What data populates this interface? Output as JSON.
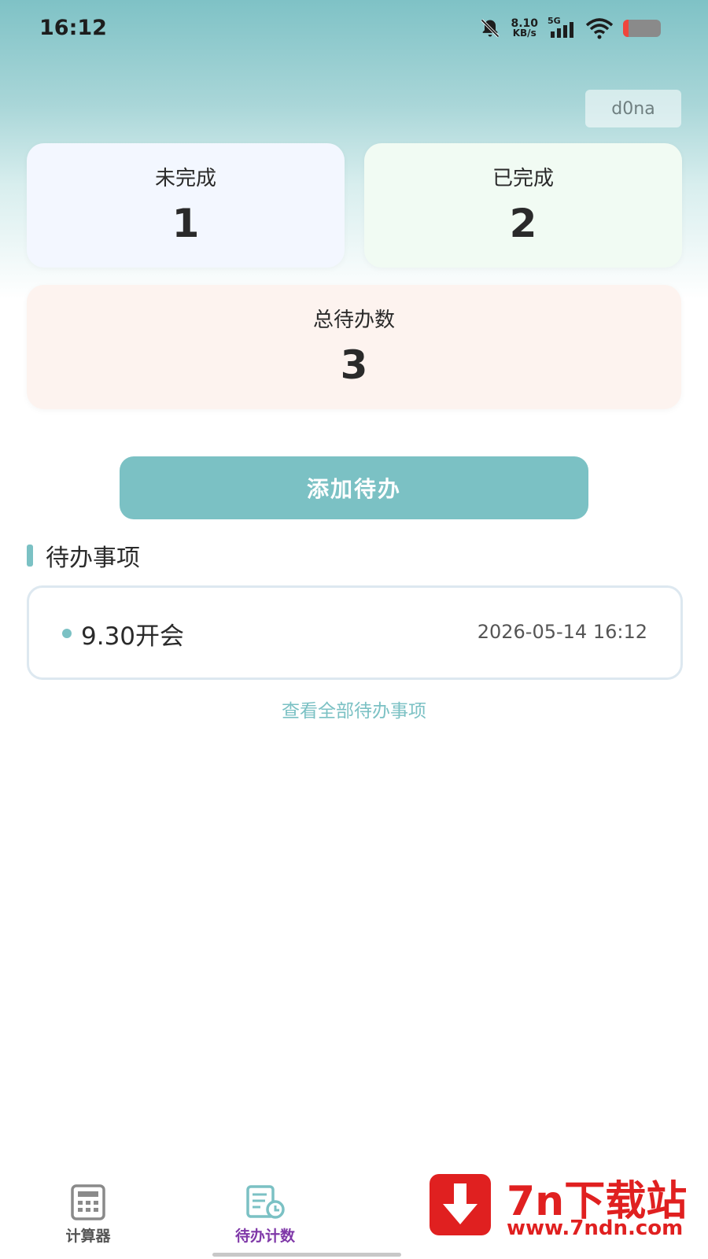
{
  "status_bar": {
    "time": "16:12",
    "net_speed_value": "8.10",
    "net_speed_unit": "KB/s",
    "network": "5G",
    "icons": [
      "bell-off-icon",
      "signal-icon",
      "wifi-icon",
      "battery-icon"
    ],
    "battery_level": 0.15
  },
  "user": {
    "name": "d0na"
  },
  "stats": {
    "incomplete": {
      "label": "未完成",
      "value": "1"
    },
    "completed": {
      "label": "已完成",
      "value": "2"
    },
    "total": {
      "label": "总待办数",
      "value": "3"
    }
  },
  "add_button_label": "添加待办",
  "section_title": "待办事项",
  "todos": [
    {
      "title": "9.30开会",
      "time": "2026-05-14 16:12"
    }
  ],
  "view_all_label": "查看全部待办事项",
  "bottom_nav": {
    "items": [
      {
        "label": "计算器",
        "icon": "calculator-icon",
        "active": false
      },
      {
        "label": "待办计数",
        "icon": "todo-list-icon",
        "active": true
      }
    ]
  },
  "watermark": {
    "title": "7n下载站",
    "url": "www.7ndn.com"
  },
  "colors": {
    "accent": "#7bc1c4",
    "active_nav": "#7f38a8",
    "watermark_red": "#e02020",
    "battery_low": "#f0463c"
  }
}
